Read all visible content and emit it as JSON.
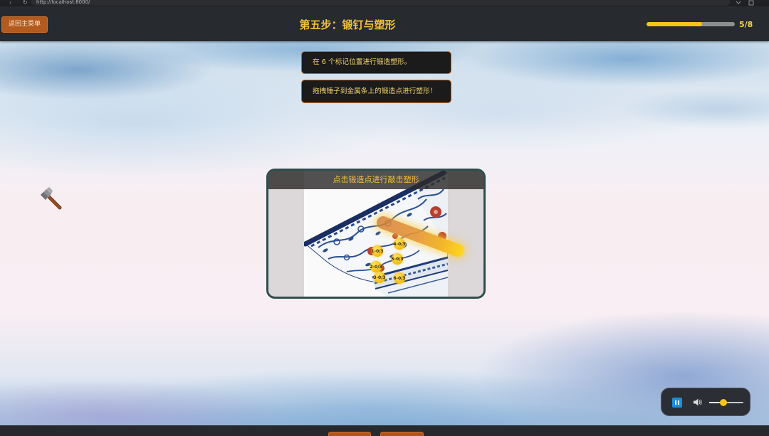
{
  "browser": {
    "url": "http://localhost:8000/"
  },
  "header": {
    "back_label": "返回主菜单",
    "title": "第五步：锻钉与塑形",
    "progress": {
      "current": 5,
      "total": 8,
      "text": "5/8"
    }
  },
  "instructions": [
    {
      "text": "在 6 个标记位置进行锻造塑形。"
    },
    {
      "text": "拖拽锤子到金属条上的锻造点进行塑形！"
    }
  ],
  "forge_panel": {
    "title": "点击锻造点进行敲击塑形",
    "points": [
      {
        "label": "1-0/3"
      },
      {
        "label": "2-0/3"
      },
      {
        "label": "3-0/3"
      },
      {
        "label": "4-0/3"
      },
      {
        "label": "5-0/3"
      },
      {
        "label": "6-0/3"
      }
    ]
  },
  "audio": {
    "volume_level": 0.42
  },
  "icons": {
    "tool": "hammer-icon",
    "pause": "pause-icon",
    "volume": "speaker-icon"
  },
  "colors": {
    "accent": "#f5c518",
    "title": "#f3c23a",
    "button": "#b35a1f",
    "instruction_border": "#c8641e",
    "panel_border": "#2e4d4d",
    "pause_button": "#1b8ed8"
  }
}
